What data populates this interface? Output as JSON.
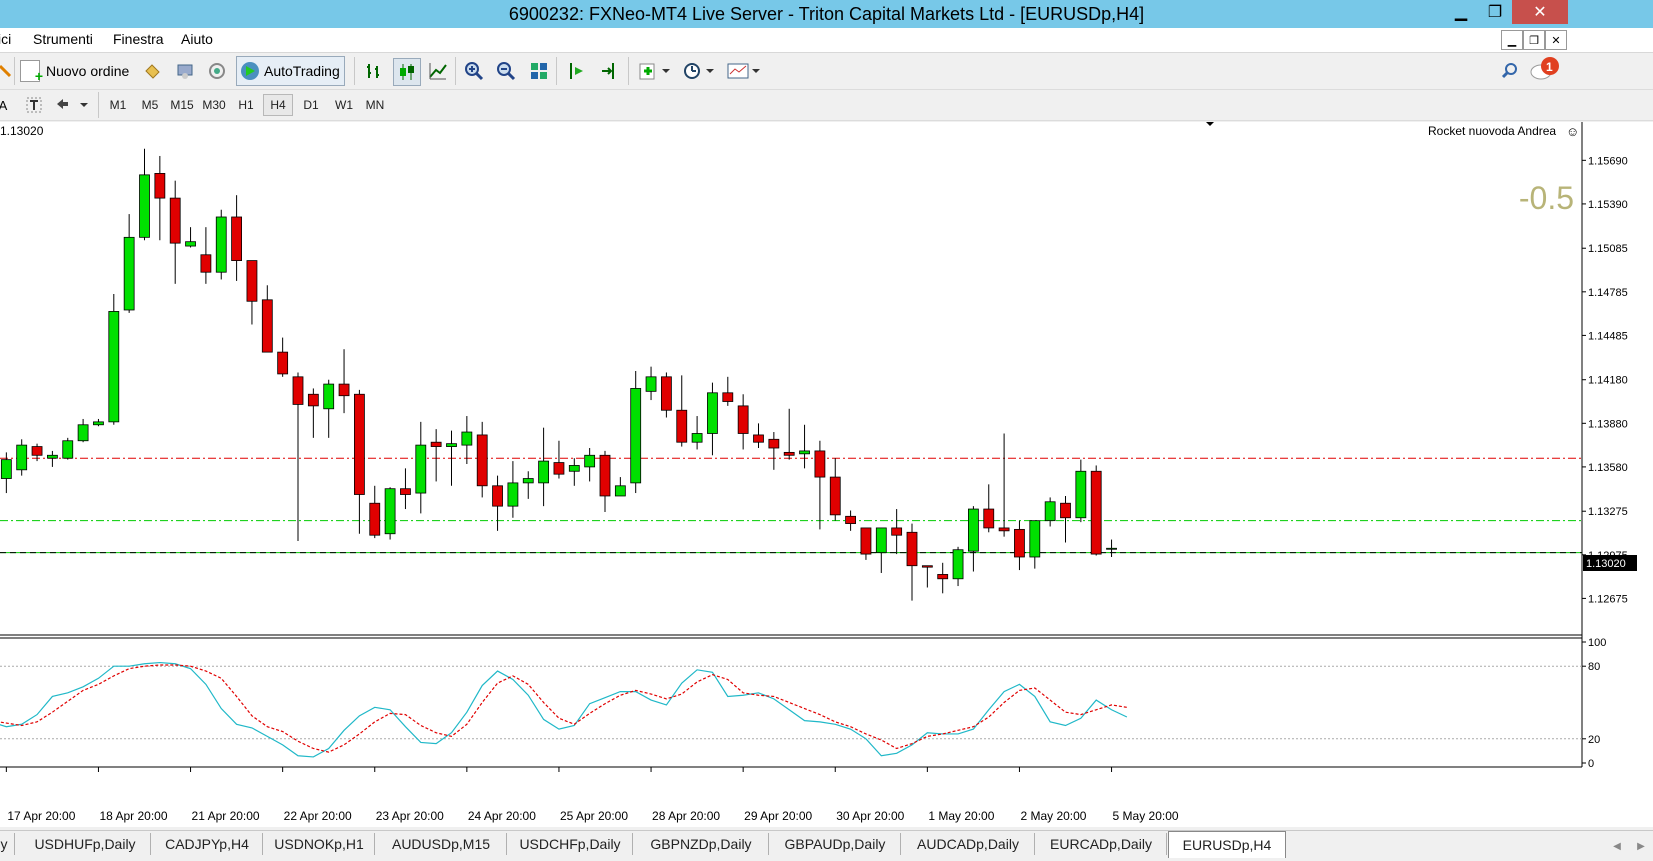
{
  "window": {
    "title": "6900232: FXNeo-MT4 Live Server - Triton Capital Markets Ltd - [EURUSDp,H4]",
    "minimize": "▁",
    "restore": "❐",
    "close": "✕"
  },
  "menu": {
    "items": [
      "ici",
      "Strumenti",
      "Finestra",
      "Aiuto"
    ]
  },
  "toolbar": {
    "new_order_label": "Nuovo ordine",
    "autotrading_label": "AutoTrading",
    "notification_count": "1"
  },
  "timeframes": [
    "M1",
    "M5",
    "M15",
    "M30",
    "H1",
    "H4",
    "D1",
    "W1",
    "MN"
  ],
  "active_timeframe": "H4",
  "chart": {
    "header_price": "1.13020",
    "expert_label": "Rocket nuovoda Andrea",
    "overlay_value": "-0.5",
    "current_price_label": "1.13020",
    "colors": {
      "bull": "#00e000",
      "bear": "#e00000",
      "resistance_line": "#e00000",
      "support_line": "#00cc00",
      "price_line": "#000000",
      "overlay_text": "#b8b478",
      "stoch_main": "#20b8c8",
      "stoch_signal": "#e00000"
    }
  },
  "chart_data": {
    "type": "candlestick",
    "symbol": "EURUSDp",
    "timeframe": "H4",
    "price_axis_ticks": [
      "1.15690",
      "1.15390",
      "1.15085",
      "1.14785",
      "1.14485",
      "1.14180",
      "1.13880",
      "1.13580",
      "1.13275",
      "1.12975",
      "1.12675"
    ],
    "ylim": [
      1.1243,
      1.1594
    ],
    "time_labels": [
      "17 Apr 20:00",
      "18 Apr 20:00",
      "21 Apr 20:00",
      "22 Apr 20:00",
      "23 Apr 20:00",
      "24 Apr 20:00",
      "25 Apr 20:00",
      "28 Apr 20:00",
      "29 Apr 20:00",
      "30 Apr 20:00",
      "1 May 20:00",
      "2 May 20:00",
      "5 May 20:00"
    ],
    "time_label_bar_index": [
      1,
      7,
      13,
      19,
      25,
      31,
      37,
      43,
      49,
      55,
      61,
      67,
      73
    ],
    "horizontal_levels": [
      {
        "price": 1.1364,
        "style": "dash-dot",
        "color": "red"
      },
      {
        "price": 1.1321,
        "style": "dash-dot",
        "color": "green"
      },
      {
        "price": 1.1299,
        "style": "solid",
        "color": "green"
      },
      {
        "price": 1.1299,
        "style": "dashed",
        "color": "black"
      }
    ],
    "candles": [
      {
        "o": 1.1359,
        "h": 1.1382,
        "l": 1.134,
        "c": 1.1353
      },
      {
        "o": 1.135,
        "h": 1.1368,
        "l": 1.134,
        "c": 1.1363
      },
      {
        "o": 1.1356,
        "h": 1.1377,
        "l": 1.1352,
        "c": 1.1373
      },
      {
        "o": 1.1372,
        "h": 1.1374,
        "l": 1.1362,
        "c": 1.1366
      },
      {
        "o": 1.1364,
        "h": 1.1369,
        "l": 1.1358,
        "c": 1.1366
      },
      {
        "o": 1.1364,
        "h": 1.1378,
        "l": 1.1363,
        "c": 1.1376
      },
      {
        "o": 1.1376,
        "h": 1.1391,
        "l": 1.1375,
        "c": 1.1387
      },
      {
        "o": 1.1387,
        "h": 1.1391,
        "l": 1.1386,
        "c": 1.1389
      },
      {
        "o": 1.1389,
        "h": 1.1477,
        "l": 1.1387,
        "c": 1.1465
      },
      {
        "o": 1.1466,
        "h": 1.1532,
        "l": 1.1464,
        "c": 1.1516
      },
      {
        "o": 1.1516,
        "h": 1.1577,
        "l": 1.1514,
        "c": 1.1559
      },
      {
        "o": 1.156,
        "h": 1.1572,
        "l": 1.1514,
        "c": 1.1543
      },
      {
        "o": 1.1543,
        "h": 1.1555,
        "l": 1.1484,
        "c": 1.1512
      },
      {
        "o": 1.151,
        "h": 1.1523,
        "l": 1.1509,
        "c": 1.1513
      },
      {
        "o": 1.1504,
        "h": 1.1523,
        "l": 1.1484,
        "c": 1.1492
      },
      {
        "o": 1.1492,
        "h": 1.1535,
        "l": 1.1487,
        "c": 1.153
      },
      {
        "o": 1.153,
        "h": 1.1545,
        "l": 1.1486,
        "c": 1.15
      },
      {
        "o": 1.15,
        "h": 1.1499,
        "l": 1.1456,
        "c": 1.1472
      },
      {
        "o": 1.1473,
        "h": 1.1483,
        "l": 1.1437,
        "c": 1.1437
      },
      {
        "o": 1.1437,
        "h": 1.1447,
        "l": 1.142,
        "c": 1.1422
      },
      {
        "o": 1.142,
        "h": 1.1423,
        "l": 1.1307,
        "c": 1.1401
      },
      {
        "o": 1.1408,
        "h": 1.1412,
        "l": 1.1378,
        "c": 1.14
      },
      {
        "o": 1.1398,
        "h": 1.1418,
        "l": 1.1378,
        "c": 1.1415
      },
      {
        "o": 1.1415,
        "h": 1.1439,
        "l": 1.1395,
        "c": 1.1407
      },
      {
        "o": 1.1408,
        "h": 1.1411,
        "l": 1.1312,
        "c": 1.1339
      },
      {
        "o": 1.1333,
        "h": 1.1345,
        "l": 1.1309,
        "c": 1.1311
      },
      {
        "o": 1.1312,
        "h": 1.1344,
        "l": 1.1308,
        "c": 1.1343
      },
      {
        "o": 1.1343,
        "h": 1.1357,
        "l": 1.1329,
        "c": 1.1339
      },
      {
        "o": 1.134,
        "h": 1.1389,
        "l": 1.1326,
        "c": 1.1373
      },
      {
        "o": 1.1375,
        "h": 1.1384,
        "l": 1.1348,
        "c": 1.1372
      },
      {
        "o": 1.1372,
        "h": 1.1383,
        "l": 1.1345,
        "c": 1.1374
      },
      {
        "o": 1.1373,
        "h": 1.1393,
        "l": 1.136,
        "c": 1.1382
      },
      {
        "o": 1.138,
        "h": 1.1389,
        "l": 1.1337,
        "c": 1.1345
      },
      {
        "o": 1.1345,
        "h": 1.1352,
        "l": 1.1314,
        "c": 1.1331
      },
      {
        "o": 1.1331,
        "h": 1.1362,
        "l": 1.1323,
        "c": 1.1347
      },
      {
        "o": 1.1347,
        "h": 1.1355,
        "l": 1.1336,
        "c": 1.135
      },
      {
        "o": 1.1347,
        "h": 1.1385,
        "l": 1.1331,
        "c": 1.1362
      },
      {
        "o": 1.1361,
        "h": 1.1376,
        "l": 1.135,
        "c": 1.1353
      },
      {
        "o": 1.1355,
        "h": 1.1364,
        "l": 1.1345,
        "c": 1.1359
      },
      {
        "o": 1.1358,
        "h": 1.1371,
        "l": 1.1348,
        "c": 1.1366
      },
      {
        "o": 1.1366,
        "h": 1.1369,
        "l": 1.1327,
        "c": 1.1338
      },
      {
        "o": 1.1338,
        "h": 1.1351,
        "l": 1.1338,
        "c": 1.1345
      },
      {
        "o": 1.1347,
        "h": 1.1424,
        "l": 1.134,
        "c": 1.1412
      },
      {
        "o": 1.141,
        "h": 1.1427,
        "l": 1.1404,
        "c": 1.142
      },
      {
        "o": 1.142,
        "h": 1.1423,
        "l": 1.1392,
        "c": 1.1397
      },
      {
        "o": 1.1397,
        "h": 1.1421,
        "l": 1.1372,
        "c": 1.1375
      },
      {
        "o": 1.1375,
        "h": 1.1393,
        "l": 1.137,
        "c": 1.1381
      },
      {
        "o": 1.1381,
        "h": 1.1416,
        "l": 1.1366,
        "c": 1.1409
      },
      {
        "o": 1.1409,
        "h": 1.142,
        "l": 1.14,
        "c": 1.1403
      },
      {
        "o": 1.14,
        "h": 1.1408,
        "l": 1.137,
        "c": 1.1381
      },
      {
        "o": 1.138,
        "h": 1.1388,
        "l": 1.1371,
        "c": 1.1375
      },
      {
        "o": 1.1377,
        "h": 1.1382,
        "l": 1.1356,
        "c": 1.1371
      },
      {
        "o": 1.1368,
        "h": 1.1398,
        "l": 1.1363,
        "c": 1.1366
      },
      {
        "o": 1.1367,
        "h": 1.1387,
        "l": 1.1357,
        "c": 1.1369
      },
      {
        "o": 1.1369,
        "h": 1.1376,
        "l": 1.1315,
        "c": 1.1351
      },
      {
        "o": 1.1351,
        "h": 1.1364,
        "l": 1.1321,
        "c": 1.1325
      },
      {
        "o": 1.1324,
        "h": 1.1328,
        "l": 1.1314,
        "c": 1.1319
      },
      {
        "o": 1.1316,
        "h": 1.1312,
        "l": 1.1294,
        "c": 1.1298
      },
      {
        "o": 1.1299,
        "h": 1.1316,
        "l": 1.1285,
        "c": 1.1316
      },
      {
        "o": 1.1316,
        "h": 1.1329,
        "l": 1.1298,
        "c": 1.1311
      },
      {
        "o": 1.1313,
        "h": 1.1319,
        "l": 1.1266,
        "c": 1.129
      },
      {
        "o": 1.129,
        "h": 1.129,
        "l": 1.1275,
        "c": 1.1289
      },
      {
        "o": 1.1284,
        "h": 1.1292,
        "l": 1.1271,
        "c": 1.1281
      },
      {
        "o": 1.1281,
        "h": 1.1303,
        "l": 1.1276,
        "c": 1.1301
      },
      {
        "o": 1.13,
        "h": 1.1331,
        "l": 1.1286,
        "c": 1.1329
      },
      {
        "o": 1.1329,
        "h": 1.1346,
        "l": 1.1313,
        "c": 1.1316
      },
      {
        "o": 1.1316,
        "h": 1.1381,
        "l": 1.131,
        "c": 1.1314
      },
      {
        "o": 1.1315,
        "h": 1.1321,
        "l": 1.1287,
        "c": 1.1296
      },
      {
        "o": 1.1296,
        "h": 1.1318,
        "l": 1.1288,
        "c": 1.1321
      },
      {
        "o": 1.1321,
        "h": 1.1337,
        "l": 1.1317,
        "c": 1.1334
      },
      {
        "o": 1.1333,
        "h": 1.1338,
        "l": 1.1306,
        "c": 1.1323
      },
      {
        "o": 1.1323,
        "h": 1.1363,
        "l": 1.132,
        "c": 1.1355
      },
      {
        "o": 1.1355,
        "h": 1.1359,
        "l": 1.1297,
        "c": 1.1298
      },
      {
        "o": 1.1302,
        "h": 1.1308,
        "l": 1.1296,
        "c": 1.1302
      }
    ],
    "indicator": {
      "name": "Stochastic",
      "levels": [
        100,
        80,
        20,
        0
      ],
      "main": [
        34,
        30,
        32,
        40,
        55,
        58,
        63,
        70,
        80,
        80,
        82,
        83,
        82,
        78,
        65,
        45,
        32,
        29,
        22,
        15,
        6,
        5,
        12,
        27,
        39,
        46,
        44,
        30,
        17,
        16,
        25,
        42,
        64,
        76,
        69,
        56,
        36,
        28,
        31,
        49,
        54,
        59,
        59,
        52,
        48,
        66,
        77,
        75,
        55,
        56,
        58,
        53,
        44,
        35,
        34,
        32,
        28,
        20,
        6,
        8,
        15,
        25,
        24,
        24,
        28,
        44,
        59,
        65,
        55,
        34,
        31,
        37,
        52,
        44,
        38
      ],
      "signal": [
        35,
        33,
        31,
        34,
        42,
        51,
        60,
        65,
        72,
        78,
        80,
        81,
        81,
        80,
        76,
        70,
        55,
        39,
        30,
        26,
        18,
        12,
        9,
        15,
        24,
        34,
        41,
        40,
        31,
        25,
        22,
        32,
        50,
        66,
        72,
        65,
        50,
        37,
        32,
        41,
        49,
        56,
        60,
        57,
        53,
        57,
        67,
        73,
        69,
        58,
        56,
        55,
        50,
        45,
        40,
        34,
        30,
        24,
        19,
        12,
        16,
        22,
        24,
        27,
        30,
        38,
        50,
        60,
        62,
        52,
        42,
        40,
        44,
        48,
        46
      ]
    }
  },
  "symbol_tabs": [
    "y",
    "USDHUFp,Daily",
    "CADJPYp,H4",
    "USDNOKp,H1",
    "AUDUSDp,M15",
    "USDCHFp,Daily",
    "GBPNZDp,Daily",
    "GBPAUDp,Daily",
    "AUDCADp,Daily",
    "EURCADp,Daily",
    "EURUSDp,H4"
  ],
  "active_tab": "EURUSDp,H4"
}
